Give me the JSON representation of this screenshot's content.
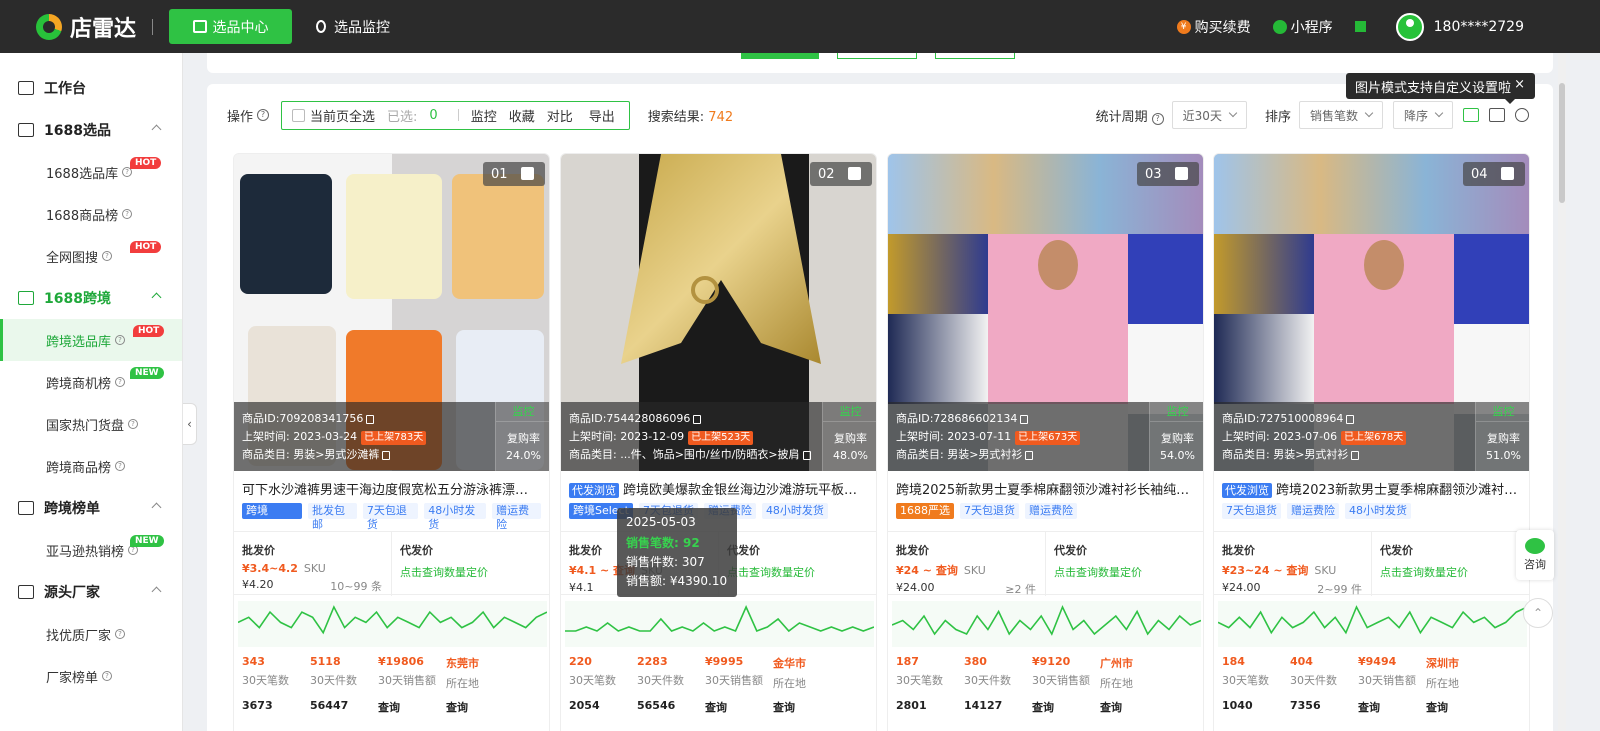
{
  "header": {
    "logo_text": "店雷达",
    "nav_active": "选品中心",
    "nav_monitor": "选品监控",
    "buy": "购买续费",
    "coin_glyph": "¥",
    "miniprogram": "小程序",
    "user": "180****2729"
  },
  "sidebar": {
    "workbench": "工作台",
    "groups": [
      {
        "label": "1688选品",
        "items": [
          {
            "label": "1688选品库",
            "tag": "HOT"
          },
          {
            "label": "1688商品榜",
            "tag": ""
          },
          {
            "label": "全网图搜",
            "tag": "HOT"
          }
        ]
      },
      {
        "label": "1688跨境",
        "items": [
          {
            "label": "跨境选品库",
            "tag": "HOT"
          },
          {
            "label": "跨境商机榜",
            "tag": "NEW"
          },
          {
            "label": "国家热门货盘",
            "tag": ""
          },
          {
            "label": "跨境商品榜",
            "tag": ""
          }
        ]
      },
      {
        "label": "跨境榜单",
        "items": [
          {
            "label": "亚马逊热销榜",
            "tag": "NEW"
          }
        ]
      },
      {
        "label": "源头厂家",
        "items": [
          {
            "label": "找优质厂家",
            "tag": ""
          },
          {
            "label": "厂家榜单",
            "tag": ""
          }
        ]
      }
    ],
    "collapse_glyph": "‹"
  },
  "toolbar": {
    "op_label": "操作",
    "select_all": "当前页全选",
    "selected_label": "已选:",
    "selected_count": "0",
    "actions": [
      "监控",
      "收藏",
      "对比",
      "导出"
    ],
    "results_label": "搜索结果:",
    "results_count": "742",
    "period_label": "统计周期",
    "period_value": "近30天",
    "sort_label": "排序",
    "sort_value": "销售笔数",
    "order_value": "降序",
    "tip": "图片模式支持自定义设置啦",
    "tip_close": "×"
  },
  "common": {
    "id_label": "商品ID:",
    "time_label": "上架时间:",
    "cat_label": "商品类目:",
    "monitor": "监控",
    "repurchase": "复购率",
    "wholesale": "批发价",
    "dropship": "代发价",
    "dropship_link": "点击查询数量定价",
    "sku": "SKU",
    "stat_labels": [
      "30天笔数",
      "30天件数",
      "30天销售额",
      "所在地"
    ],
    "query": "查询"
  },
  "products": [
    {
      "no": "01",
      "id": "709208341756",
      "time": "2023-03-24",
      "listed": "已上架783天",
      "cat": "男装>男式沙滩裤",
      "repurchase": "24.0%",
      "title_prefix": "",
      "title": "可下水沙滩裤男速干海边度假宽松五分游泳裤漂流冲...",
      "tags": [
        {
          "t": "跨境Select",
          "k": "t-blue"
        },
        {
          "t": "批发包邮",
          "k": ""
        },
        {
          "t": "7天包退货",
          "k": ""
        },
        {
          "t": "48小时发货",
          "k": ""
        },
        {
          "t": "赠运费险",
          "k": ""
        }
      ],
      "price": "¥3.4~4.2",
      "price_sub": "¥4.20",
      "range": "10~99 条",
      "stats": [
        "343",
        "5118",
        "¥19806",
        "东莞市"
      ],
      "stats2": [
        "3673",
        "56447",
        "查询",
        "查询"
      ],
      "spark": [
        4,
        5,
        3,
        6,
        4,
        3,
        6,
        5,
        2,
        7,
        3,
        5,
        4,
        6,
        3,
        5,
        4,
        3,
        6,
        4,
        5,
        3,
        4,
        6,
        3,
        5,
        4,
        3,
        5,
        6
      ]
    },
    {
      "no": "02",
      "id": "754428086096",
      "time": "2023-12-09",
      "listed": "已上架523天",
      "cat": "...件、饰品>围巾/丝巾/防晒衣>披肩",
      "repurchase": "48.0%",
      "title_prefix": "代发浏览",
      "title": "跨境欧美爆款金银丝海边沙滩游玩平板巾流...",
      "tags": [
        {
          "t": "跨境Select",
          "k": "t-blue"
        },
        {
          "t": "7天包退货",
          "k": ""
        },
        {
          "t": "赠运费险",
          "k": ""
        },
        {
          "t": "48小时发货",
          "k": ""
        }
      ],
      "price": "¥4.1 ~ 查询",
      "price_sub": "¥4.1",
      "range": "",
      "stats": [
        "220",
        "2283",
        "¥9995",
        "金华市"
      ],
      "stats2": [
        "2054",
        "56546",
        "查询",
        "查询"
      ],
      "spark": [
        3,
        3,
        4,
        3,
        5,
        3,
        4,
        3,
        3,
        6,
        3,
        4,
        3,
        5,
        3,
        4,
        3,
        9,
        3,
        4,
        6,
        3,
        5,
        4,
        3,
        4,
        3,
        4,
        3,
        4
      ]
    },
    {
      "no": "03",
      "id": "728686602134",
      "time": "2023-07-11",
      "listed": "已上架673天",
      "cat": "男装>男式衬衫",
      "repurchase": "54.0%",
      "title_prefix": "",
      "title": "跨境2025新款男士夏季棉麻翻领沙滩衬衫长袖纯色夏...",
      "tags": [
        {
          "t": "1688严选",
          "k": "t-orange"
        },
        {
          "t": "7天包退货",
          "k": ""
        },
        {
          "t": "赠运费险",
          "k": ""
        }
      ],
      "price": "¥24 ~ 查询",
      "price_sub": "¥24.00",
      "range": "≥2 件",
      "stats": [
        "187",
        "380",
        "¥9120",
        "广州市"
      ],
      "stats2": [
        "2801",
        "14127",
        "查询",
        "查询"
      ],
      "spark": [
        4,
        5,
        3,
        6,
        2,
        5,
        3,
        2,
        6,
        3,
        7,
        2,
        5,
        3,
        6,
        2,
        8,
        3,
        5,
        2,
        4,
        6,
        3,
        7,
        2,
        5,
        3,
        6,
        4,
        5
      ]
    },
    {
      "no": "04",
      "id": "727510008964",
      "time": "2023-07-06",
      "listed": "已上架678天",
      "cat": "男装>男式衬衫",
      "repurchase": "51.0%",
      "title_prefix": "代发浏览",
      "title": "跨境2023新款男士夏季棉麻翻领沙滩衬衫...",
      "tags": [
        {
          "t": "7天包退货",
          "k": ""
        },
        {
          "t": "赠运费险",
          "k": ""
        },
        {
          "t": "48小时发货",
          "k": ""
        }
      ],
      "price": "¥23~24 ~ 查询",
      "price_sub": "¥24.00",
      "range": "2~99 件",
      "stats": [
        "184",
        "404",
        "¥9494",
        "深圳市"
      ],
      "stats2": [
        "1040",
        "7356",
        "查询",
        "查询"
      ],
      "spark": [
        4,
        3,
        5,
        3,
        6,
        2,
        5,
        3,
        4,
        6,
        3,
        5,
        2,
        7,
        3,
        4,
        5,
        3,
        6,
        2,
        5,
        4,
        3,
        6,
        4,
        5,
        3,
        4,
        6,
        7
      ]
    }
  ],
  "hover_tip": {
    "date": "2025-05-03",
    "orders_label": "销售笔数:",
    "orders": "92",
    "pieces_label": "销售件数:",
    "pieces": "307",
    "amount_label": "销售额:",
    "amount": "¥4390.10"
  },
  "side": {
    "consult": "咨询",
    "top_glyph": "⌃"
  }
}
